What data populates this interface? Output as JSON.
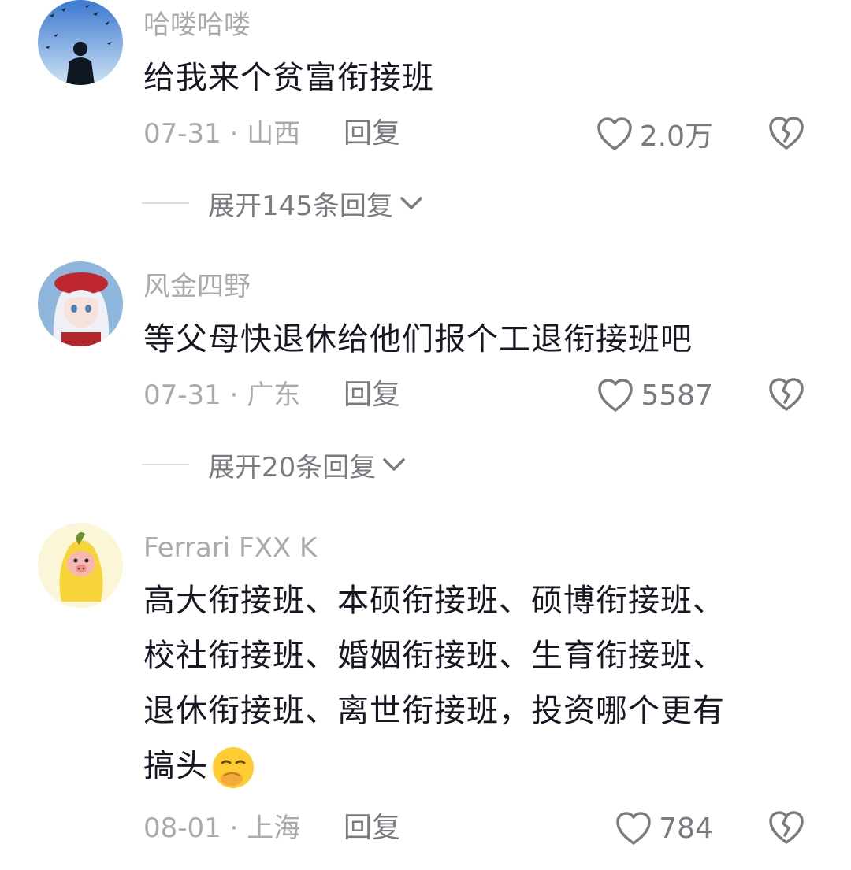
{
  "comments": [
    {
      "username": "哈喽哈喽",
      "text_lines": [
        "给我来个贫富衔接班"
      ],
      "meta": "07-31 · 山西",
      "reply_label": "回复",
      "likes": "2.0万",
      "expand_label": "展开145条回复",
      "avatar_icon": "man-with-birds-avatar"
    },
    {
      "username": "风金四野",
      "text_lines": [
        "等父母快退休给他们报个工退衔接班吧"
      ],
      "meta": "07-31 · 广东",
      "reply_label": "回复",
      "likes": "5587",
      "expand_label": "展开20条回复",
      "avatar_icon": "anime-girl-avatar"
    },
    {
      "username": "Ferrari  FXX  K",
      "text_lines": [
        "高大衔接班、本硕衔接班、硕博衔接班、",
        "校社衔接班、婚姻衔接班、生育衔接班、",
        "退休衔接班、离世衔接班，投资哪个更有",
        "搞头"
      ],
      "text_emoji": "smirk-hand-over-mouth-emoji",
      "meta": "08-01 · 上海",
      "reply_label": "回复",
      "likes": "784",
      "avatar_icon": "banana-pig-avatar"
    }
  ],
  "icons": {
    "like": "heart-outline-icon",
    "dislike": "broken-heart-icon",
    "expand": "chevron-down-icon"
  },
  "colors": {
    "text": "#161823",
    "secondary": "#a9aaad",
    "action": "#7a7b80"
  }
}
